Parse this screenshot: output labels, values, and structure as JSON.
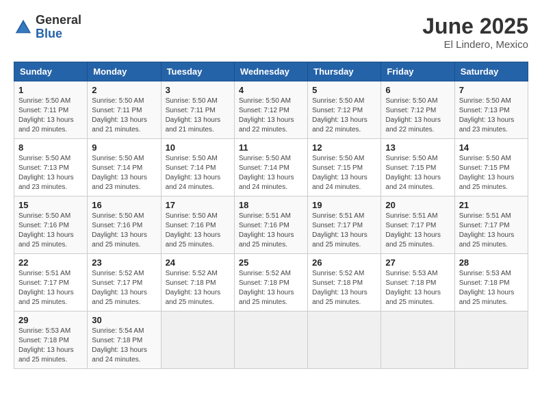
{
  "logo": {
    "general": "General",
    "blue": "Blue"
  },
  "title": "June 2025",
  "subtitle": "El Lindero, Mexico",
  "headers": [
    "Sunday",
    "Monday",
    "Tuesday",
    "Wednesday",
    "Thursday",
    "Friday",
    "Saturday"
  ],
  "weeks": [
    [
      {
        "day": "1",
        "info": "Sunrise: 5:50 AM\nSunset: 7:11 PM\nDaylight: 13 hours\nand 20 minutes."
      },
      {
        "day": "2",
        "info": "Sunrise: 5:50 AM\nSunset: 7:11 PM\nDaylight: 13 hours\nand 21 minutes."
      },
      {
        "day": "3",
        "info": "Sunrise: 5:50 AM\nSunset: 7:11 PM\nDaylight: 13 hours\nand 21 minutes."
      },
      {
        "day": "4",
        "info": "Sunrise: 5:50 AM\nSunset: 7:12 PM\nDaylight: 13 hours\nand 22 minutes."
      },
      {
        "day": "5",
        "info": "Sunrise: 5:50 AM\nSunset: 7:12 PM\nDaylight: 13 hours\nand 22 minutes."
      },
      {
        "day": "6",
        "info": "Sunrise: 5:50 AM\nSunset: 7:12 PM\nDaylight: 13 hours\nand 22 minutes."
      },
      {
        "day": "7",
        "info": "Sunrise: 5:50 AM\nSunset: 7:13 PM\nDaylight: 13 hours\nand 23 minutes."
      }
    ],
    [
      {
        "day": "8",
        "info": "Sunrise: 5:50 AM\nSunset: 7:13 PM\nDaylight: 13 hours\nand 23 minutes."
      },
      {
        "day": "9",
        "info": "Sunrise: 5:50 AM\nSunset: 7:14 PM\nDaylight: 13 hours\nand 23 minutes."
      },
      {
        "day": "10",
        "info": "Sunrise: 5:50 AM\nSunset: 7:14 PM\nDaylight: 13 hours\nand 24 minutes."
      },
      {
        "day": "11",
        "info": "Sunrise: 5:50 AM\nSunset: 7:14 PM\nDaylight: 13 hours\nand 24 minutes."
      },
      {
        "day": "12",
        "info": "Sunrise: 5:50 AM\nSunset: 7:15 PM\nDaylight: 13 hours\nand 24 minutes."
      },
      {
        "day": "13",
        "info": "Sunrise: 5:50 AM\nSunset: 7:15 PM\nDaylight: 13 hours\nand 24 minutes."
      },
      {
        "day": "14",
        "info": "Sunrise: 5:50 AM\nSunset: 7:15 PM\nDaylight: 13 hours\nand 25 minutes."
      }
    ],
    [
      {
        "day": "15",
        "info": "Sunrise: 5:50 AM\nSunset: 7:16 PM\nDaylight: 13 hours\nand 25 minutes."
      },
      {
        "day": "16",
        "info": "Sunrise: 5:50 AM\nSunset: 7:16 PM\nDaylight: 13 hours\nand 25 minutes."
      },
      {
        "day": "17",
        "info": "Sunrise: 5:50 AM\nSunset: 7:16 PM\nDaylight: 13 hours\nand 25 minutes."
      },
      {
        "day": "18",
        "info": "Sunrise: 5:51 AM\nSunset: 7:16 PM\nDaylight: 13 hours\nand 25 minutes."
      },
      {
        "day": "19",
        "info": "Sunrise: 5:51 AM\nSunset: 7:17 PM\nDaylight: 13 hours\nand 25 minutes."
      },
      {
        "day": "20",
        "info": "Sunrise: 5:51 AM\nSunset: 7:17 PM\nDaylight: 13 hours\nand 25 minutes."
      },
      {
        "day": "21",
        "info": "Sunrise: 5:51 AM\nSunset: 7:17 PM\nDaylight: 13 hours\nand 25 minutes."
      }
    ],
    [
      {
        "day": "22",
        "info": "Sunrise: 5:51 AM\nSunset: 7:17 PM\nDaylight: 13 hours\nand 25 minutes."
      },
      {
        "day": "23",
        "info": "Sunrise: 5:52 AM\nSunset: 7:17 PM\nDaylight: 13 hours\nand 25 minutes."
      },
      {
        "day": "24",
        "info": "Sunrise: 5:52 AM\nSunset: 7:18 PM\nDaylight: 13 hours\nand 25 minutes."
      },
      {
        "day": "25",
        "info": "Sunrise: 5:52 AM\nSunset: 7:18 PM\nDaylight: 13 hours\nand 25 minutes."
      },
      {
        "day": "26",
        "info": "Sunrise: 5:52 AM\nSunset: 7:18 PM\nDaylight: 13 hours\nand 25 minutes."
      },
      {
        "day": "27",
        "info": "Sunrise: 5:53 AM\nSunset: 7:18 PM\nDaylight: 13 hours\nand 25 minutes."
      },
      {
        "day": "28",
        "info": "Sunrise: 5:53 AM\nSunset: 7:18 PM\nDaylight: 13 hours\nand 25 minutes."
      }
    ],
    [
      {
        "day": "29",
        "info": "Sunrise: 5:53 AM\nSunset: 7:18 PM\nDaylight: 13 hours\nand 25 minutes."
      },
      {
        "day": "30",
        "info": "Sunrise: 5:54 AM\nSunset: 7:18 PM\nDaylight: 13 hours\nand 24 minutes."
      },
      {
        "day": "",
        "info": ""
      },
      {
        "day": "",
        "info": ""
      },
      {
        "day": "",
        "info": ""
      },
      {
        "day": "",
        "info": ""
      },
      {
        "day": "",
        "info": ""
      }
    ]
  ]
}
